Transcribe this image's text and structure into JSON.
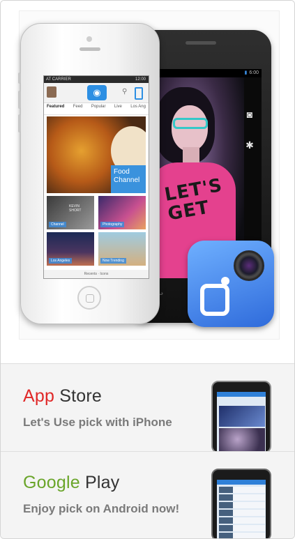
{
  "hero": {
    "iphone": {
      "status_carrier": "AT CARRIER",
      "status_time": "12:00",
      "tabs": [
        "Featured",
        "Feed",
        "Popular",
        "Live",
        "Los Ang"
      ],
      "food_badge": "Food Channel",
      "tile_labels": [
        "Channel",
        "Photography",
        "Los Angeles",
        "Now Trending"
      ],
      "tile1_text": "KEVIN SHORT",
      "footer_text": "Recents  ·  Icons"
    },
    "android": {
      "status_time": "6:00",
      "shirt_text": "LET'S GET"
    }
  },
  "stores": [
    {
      "title_part1": "App",
      "title_part2": "Store",
      "subtitle": "Let's Use pick with iPhone",
      "accent_color": "#e02828"
    },
    {
      "title_part1": "Google",
      "title_part2": "Play",
      "subtitle": "Enjoy pick on Android now!",
      "accent_color": "#6aa52a"
    }
  ],
  "icons": {
    "app_icon": "camera-app-icon",
    "camera_button": "camera-icon",
    "search": "search-icon"
  }
}
